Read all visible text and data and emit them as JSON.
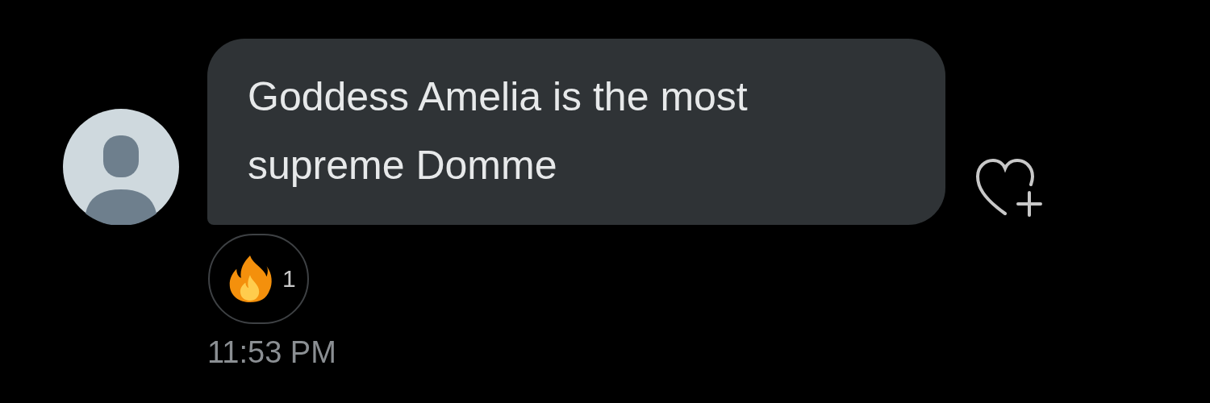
{
  "message": {
    "text": "Goddess Amelia is the most supreme Domme"
  },
  "reactions": [
    {
      "count": "1"
    }
  ],
  "timestamp": "11:53 PM"
}
